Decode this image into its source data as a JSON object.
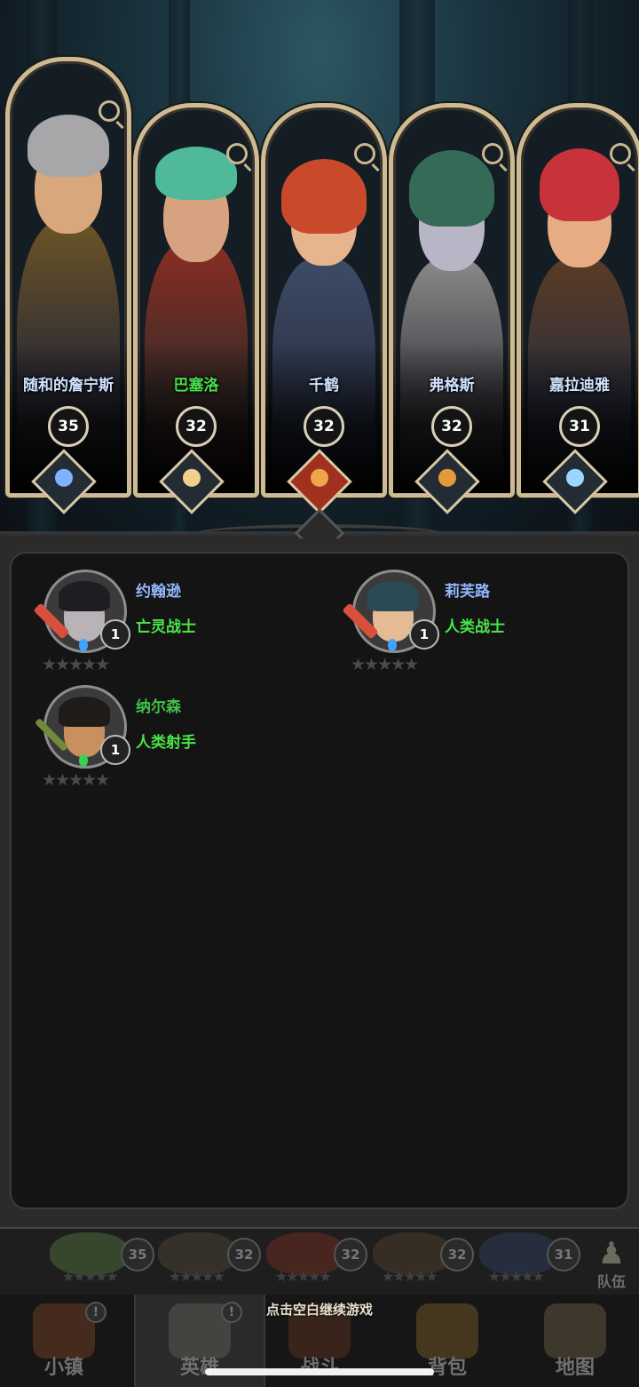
{
  "top_heroes": [
    {
      "name": "随和的詹宁斯",
      "level": "35",
      "name_color": "blue",
      "emblem": "book-emblem-icon"
    },
    {
      "name": "巴塞洛",
      "level": "32",
      "name_color": "green",
      "emblem": "star-compass-emblem-icon"
    },
    {
      "name": "千鹤",
      "level": "32",
      "name_color": "blue",
      "emblem": "shield-emblem-icon"
    },
    {
      "name": "弗格斯",
      "level": "32",
      "name_color": "blue",
      "emblem": "star-emblem-icon"
    },
    {
      "name": "嘉拉迪雅",
      "level": "31",
      "name_color": "blue",
      "emblem": "staff-emblem-icon"
    }
  ],
  "roster": [
    {
      "name": "约翰逊",
      "class": "亡灵战士",
      "level": "1",
      "stars": "★★★★★",
      "weapon": "sword-icon",
      "name_color": "blue"
    },
    {
      "name": "莉芙路",
      "class": "人类战士",
      "level": "1",
      "stars": "★★★★★",
      "weapon": "sword-icon",
      "name_color": "blue"
    },
    {
      "name": "纳尔森",
      "class": "人类射手",
      "level": "1",
      "stars": "★★★★★",
      "weapon": "bow-icon",
      "name_color": "green"
    }
  ],
  "strip_levels": [
    "35",
    "32",
    "32",
    "32",
    "31"
  ],
  "strip_stars": "★★★★★",
  "team_label": "队伍",
  "hint": "点击空白继续游戏",
  "nav": [
    {
      "label": "小镇",
      "icon": "town-icon",
      "badge": "!"
    },
    {
      "label": "英雄",
      "icon": "hero-icon",
      "badge": "!"
    },
    {
      "label": "战斗",
      "icon": "swords-icon",
      "badge": ""
    },
    {
      "label": "背包",
      "icon": "backpack-icon",
      "badge": ""
    },
    {
      "label": "地图",
      "icon": "map-icon",
      "badge": ""
    }
  ]
}
